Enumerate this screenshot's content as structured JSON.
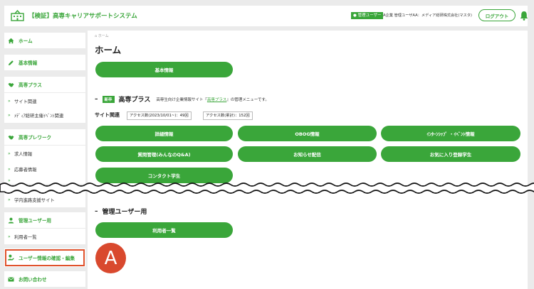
{
  "header": {
    "app_title": "【検証】高専キャリアサポートシステム",
    "admin_badge": "管理ユーザー",
    "user_name": "A企業 管理ユーザAA：メディア総研株式会社(マスタ)",
    "logout_label": "ログアウト"
  },
  "sidebar": {
    "home": "ホーム",
    "basic_info": "基本情報",
    "kosen_plus": "高専プラス",
    "site_related": "サイト関連",
    "media_events": "ﾒﾃﾞｨｱ総研主催ｲﾍﾞﾝﾄ関連",
    "kosen_prework": "高専プレワーク",
    "job_info": "求人情報",
    "applicant_info": "応募者情報",
    "campus_site": "学内進路支援サイト",
    "admin_users": "管理ユーザー用",
    "user_list": "利用者一覧",
    "user_info_edit": "ユーザー情報の確認・編集",
    "contact": "お問い合わせ"
  },
  "main": {
    "breadcrumb": "ホーム",
    "page_title": "ホーム",
    "basic_info_btn": "基本情報",
    "kosen_plus_section": {
      "badge": "新卒",
      "title": "高専プラス",
      "desc_prefix": "高専生向け企業情報サイト『",
      "desc_link": "高専プラス",
      "desc_suffix": "』の管理メニューです。"
    },
    "site_related_label": "サイト関連",
    "stat_since": "アクセス数(2023/10/01~)：49回",
    "stat_total": "アクセス数(累計)：152回",
    "buttons": {
      "details": "詳細情報",
      "obog": "OBOG情報",
      "internship": "ｲﾝﾀｰﾝｼｯﾌﾟ ・ｲﾍﾞﾝﾄ情報",
      "qa": "質問管理(みんなのQ&A)",
      "notice": "お知らせ配信",
      "favorites": "お気に入り登録学生",
      "contact_student": "コンタクト学生",
      "user_list": "利用者一覧"
    },
    "admin_section_title": "管理ユーザー用"
  },
  "avatar_letter": "A",
  "colors": {
    "accent": "#3aa63a",
    "highlight": "#e0522c",
    "avatar": "#d9492e"
  }
}
